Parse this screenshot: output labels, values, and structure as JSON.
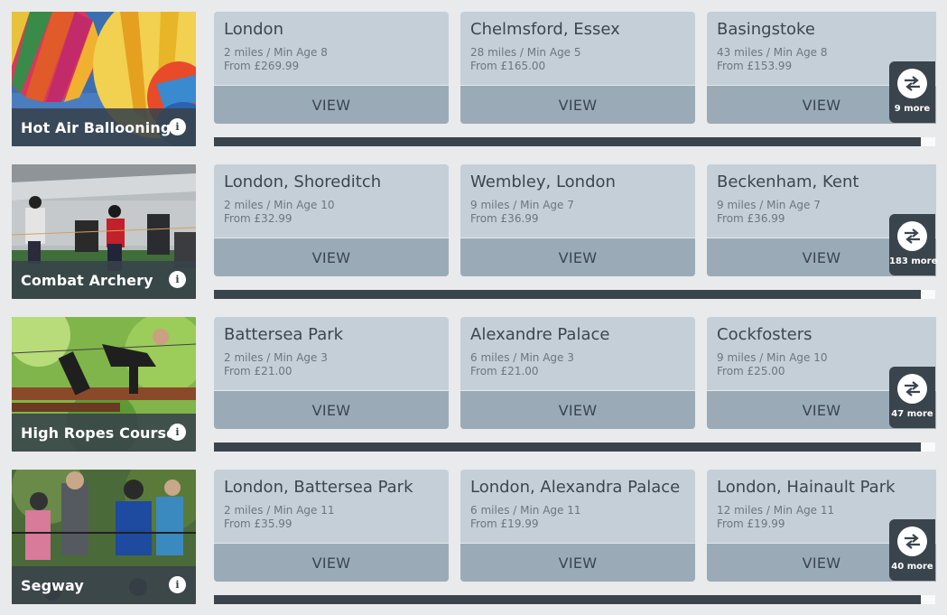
{
  "activities": [
    {
      "name": "Hot Air Ballooning",
      "image": "hot-air-balloons",
      "more": "9 more",
      "venues": [
        {
          "title": "London",
          "meta": "2 miles / Min Age 8",
          "price": "From £269.99",
          "button": "VIEW"
        },
        {
          "title": "Chelmsford, Essex",
          "meta": "28 miles / Min Age 5",
          "price": "From £165.00",
          "button": "VIEW"
        },
        {
          "title": "Basingstoke",
          "meta": "43 miles / Min Age 8",
          "price": "From £153.99",
          "button": "VIEW"
        }
      ]
    },
    {
      "name": "Combat Archery",
      "image": "combat-archery",
      "more": "183 more",
      "venues": [
        {
          "title": "London, Shoreditch",
          "meta": "2 miles / Min Age 10",
          "price": "From £32.99",
          "button": "VIEW"
        },
        {
          "title": "Wembley, London",
          "meta": "9 miles / Min Age 7",
          "price": "From £36.99",
          "button": "VIEW"
        },
        {
          "title": "Beckenham, Kent",
          "meta": "9 miles / Min Age 7",
          "price": "From £36.99",
          "button": "VIEW"
        }
      ]
    },
    {
      "name": "High Ropes Course",
      "image": "high-ropes",
      "more": "47 more",
      "venues": [
        {
          "title": "Battersea Park",
          "meta": "2 miles / Min Age 3",
          "price": "From £21.00",
          "button": "VIEW"
        },
        {
          "title": "Alexandre Palace",
          "meta": "6 miles / Min Age 3",
          "price": "From £21.00",
          "button": "VIEW"
        },
        {
          "title": "Cockfosters",
          "meta": "9 miles / Min Age 10",
          "price": "From £25.00",
          "button": "VIEW"
        }
      ]
    },
    {
      "name": "Segway",
      "image": "segway",
      "more": "40 more",
      "venues": [
        {
          "title": "London, Battersea Park",
          "meta": "2 miles / Min Age 11",
          "price": "From £35.99",
          "button": "VIEW"
        },
        {
          "title": "London, Alexandra Palace",
          "meta": "6 miles / Min Age 11",
          "price": "From £19.99",
          "button": "VIEW"
        },
        {
          "title": "London, Hainault Park",
          "meta": "12 miles / Min Age 11",
          "price": "From £19.99",
          "button": "VIEW"
        }
      ]
    }
  ],
  "icons": {
    "info": "info-icon",
    "swap": "swap-arrows-icon"
  },
  "colors": {
    "background": "#e9eaeb",
    "card": "#c5cfd7",
    "button": "#9aabb7",
    "dark": "#3a444d"
  }
}
